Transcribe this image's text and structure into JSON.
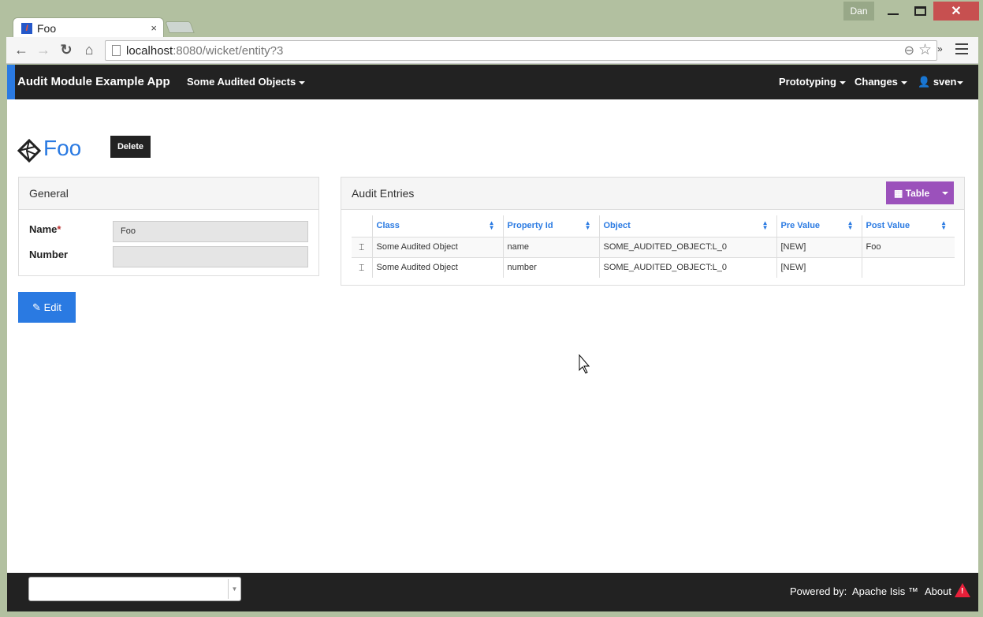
{
  "window": {
    "user": "Dan",
    "close_glyph": "✕"
  },
  "browser": {
    "tab_title": "Foo",
    "tab_favicon": "I",
    "tab_close": "×",
    "url_host": "localhost",
    "url_rest": ":8080/wicket/entity?3",
    "ext_glyph": "»"
  },
  "navbar": {
    "brand": "Audit Module Example App",
    "menu_left": "Some Audited Objects",
    "menu_prototyping": "Prototyping",
    "menu_changes": "Changes",
    "user": "sven"
  },
  "entity": {
    "title": "Foo",
    "delete_label": "Delete",
    "edit_label": "Edit"
  },
  "general": {
    "heading": "General",
    "name_label": "Name",
    "name_required": "*",
    "name_value": "Foo",
    "number_label": "Number",
    "number_value": ""
  },
  "audit": {
    "heading": "Audit Entries",
    "view_button": "Table",
    "columns": [
      "Class",
      "Property Id",
      "Object",
      "Pre Value",
      "Post Value"
    ],
    "rows": [
      {
        "class": "Some Audited Object",
        "property": "name",
        "object": "SOME_AUDITED_OBJECT:L_0",
        "pre": "[NEW]",
        "post": "Foo"
      },
      {
        "class": "Some Audited Object",
        "property": "number",
        "object": "SOME_AUDITED_OBJECT:L_0",
        "pre": "[NEW]",
        "post": ""
      }
    ]
  },
  "footer": {
    "powered_by": "Powered by:",
    "apache_isis": "Apache Isis ™",
    "about": "About"
  },
  "colors": {
    "accent": "#2a7ae2",
    "table_button": "#9b51bb",
    "warning": "#e8203a",
    "navbar": "#222222"
  }
}
